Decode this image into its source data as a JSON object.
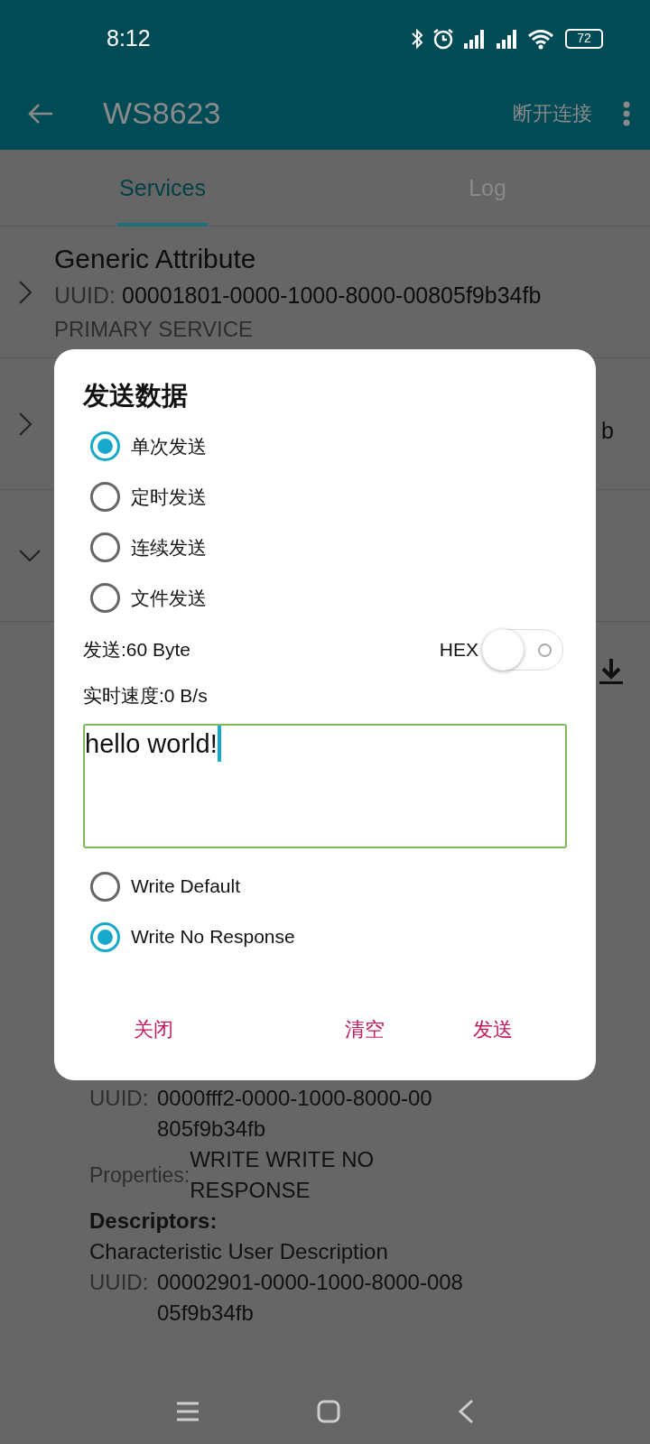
{
  "status_bar": {
    "time": "8:12",
    "battery": "72"
  },
  "app_bar": {
    "title": "WS8623",
    "action": "断开连接"
  },
  "tabs": [
    {
      "label": "Services",
      "selected": true
    },
    {
      "label": "Log",
      "selected": false
    }
  ],
  "services": [
    {
      "name": "Generic Attribute",
      "uuid_label": "UUID:",
      "uuid": "00001801-0000-1000-8000-00805f9b34fb",
      "type": "PRIMARY SERVICE",
      "expanded": false
    },
    {
      "uuid_tail": "b",
      "expanded": false
    },
    {
      "expanded": true
    }
  ],
  "characteristic": {
    "uuid_label": "UUID:",
    "uuid_lines": [
      "0000fff2-0000-1000-8000-00",
      "805f9b34fb"
    ],
    "properties_label": "Properties:",
    "properties_lines": [
      "WRITE WRITE NO",
      "RESPONSE"
    ],
    "descriptors_heading": "Descriptors:",
    "descriptor": {
      "name": "Characteristic User Description",
      "uuid_label": "UUID:",
      "uuid_lines": [
        "00002901-0000-1000-8000-008",
        "05f9b34fb"
      ]
    }
  },
  "dialog": {
    "title": "发送数据",
    "modes": [
      {
        "label": "单次发送",
        "selected": true
      },
      {
        "label": "定时发送",
        "selected": false
      },
      {
        "label": "连续发送",
        "selected": false
      },
      {
        "label": "文件发送",
        "selected": false
      }
    ],
    "sent": "发送:60 Byte",
    "hex": {
      "label": "HEX",
      "on": false
    },
    "speed": "实时速度:0 B/s",
    "input": {
      "value": "hello world!"
    },
    "write_types": [
      {
        "label": "Write Default",
        "selected": false
      },
      {
        "label": "Write No Response",
        "selected": true
      }
    ],
    "buttons": [
      "关闭",
      "清空",
      "发送"
    ]
  }
}
